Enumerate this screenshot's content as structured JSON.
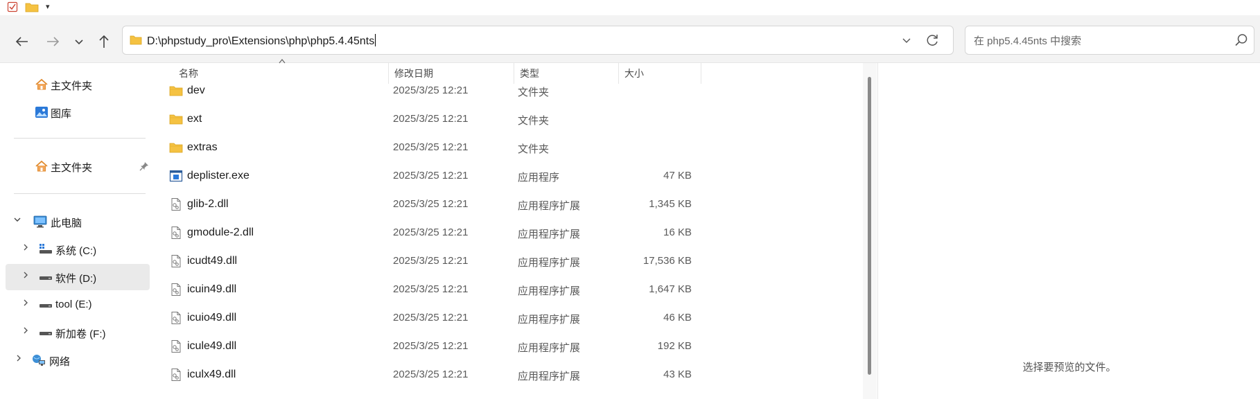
{
  "quick_access_toolbar": {
    "items": [
      "properties-icon",
      "folder-icon",
      "dropdown-icon"
    ]
  },
  "address_bar": {
    "path": "D:\\phpstudy_pro\\Extensions\\php\\php5.4.45nts"
  },
  "search": {
    "placeholder": "在 php5.4.45nts 中搜索"
  },
  "navigation": {
    "home_label": "主文件夹",
    "gallery_label": "图库",
    "pinned_home_label": "主文件夹",
    "this_pc_label": "此电脑",
    "drives": [
      {
        "label": "系统 (C:)",
        "icon": "system-drive-icon"
      },
      {
        "label": "软件 (D:)",
        "icon": "drive-icon",
        "selected": true
      },
      {
        "label": "tool (E:)",
        "icon": "drive-icon"
      },
      {
        "label": "新加卷 (F:)",
        "icon": "drive-icon"
      }
    ],
    "network_label": "网络"
  },
  "columns": {
    "name": "名称",
    "date": "修改日期",
    "type": "类型",
    "size": "大小"
  },
  "files": [
    {
      "name": "dev",
      "date": "2025/3/25 12:21",
      "type": "文件夹",
      "size": "",
      "icon": "folder-icon"
    },
    {
      "name": "ext",
      "date": "2025/3/25 12:21",
      "type": "文件夹",
      "size": "",
      "icon": "folder-icon"
    },
    {
      "name": "extras",
      "date": "2025/3/25 12:21",
      "type": "文件夹",
      "size": "",
      "icon": "folder-icon"
    },
    {
      "name": "deplister.exe",
      "date": "2025/3/25 12:21",
      "type": "应用程序",
      "size": "47 KB",
      "icon": "exe-icon"
    },
    {
      "name": "glib-2.dll",
      "date": "2025/3/25 12:21",
      "type": "应用程序扩展",
      "size": "1,345 KB",
      "icon": "dll-icon"
    },
    {
      "name": "gmodule-2.dll",
      "date": "2025/3/25 12:21",
      "type": "应用程序扩展",
      "size": "16 KB",
      "icon": "dll-icon"
    },
    {
      "name": "icudt49.dll",
      "date": "2025/3/25 12:21",
      "type": "应用程序扩展",
      "size": "17,536 KB",
      "icon": "dll-icon"
    },
    {
      "name": "icuin49.dll",
      "date": "2025/3/25 12:21",
      "type": "应用程序扩展",
      "size": "1,647 KB",
      "icon": "dll-icon"
    },
    {
      "name": "icuio49.dll",
      "date": "2025/3/25 12:21",
      "type": "应用程序扩展",
      "size": "46 KB",
      "icon": "dll-icon"
    },
    {
      "name": "icule49.dll",
      "date": "2025/3/25 12:21",
      "type": "应用程序扩展",
      "size": "192 KB",
      "icon": "dll-icon"
    },
    {
      "name": "iculx49.dll",
      "date": "2025/3/25 12:21",
      "type": "应用程序扩展",
      "size": "43 KB",
      "icon": "dll-icon"
    }
  ],
  "preview": {
    "message": "选择要预览的文件。"
  }
}
